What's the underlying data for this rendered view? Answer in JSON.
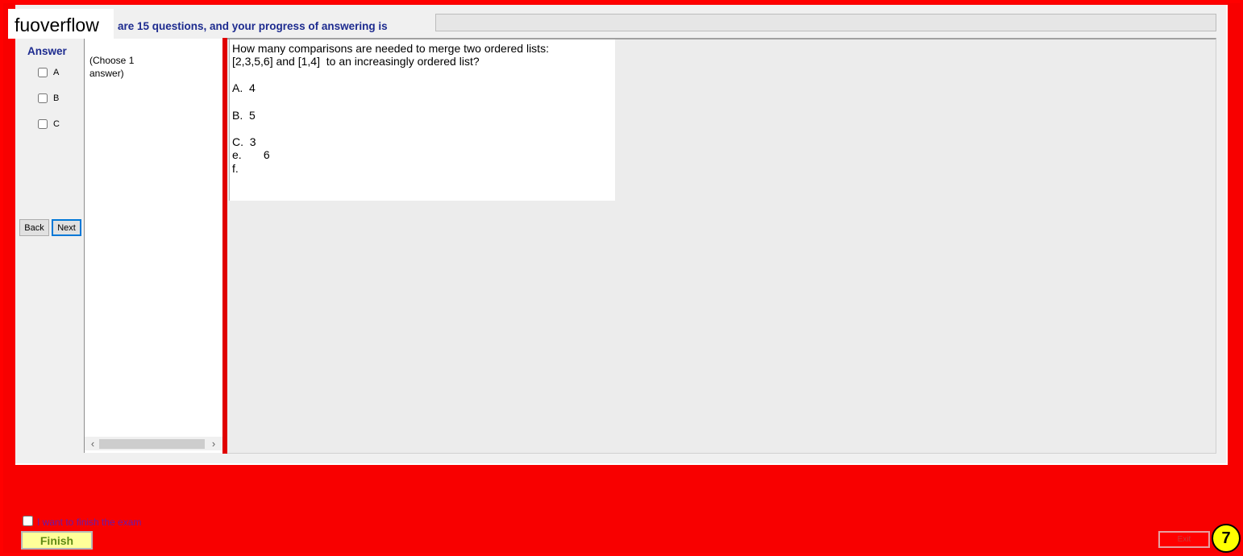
{
  "header": {
    "brand": "fuoverflow",
    "progress_text": "are 15 questions, and your progress of answering is",
    "progress_fraction": 0
  },
  "answer_panel": {
    "title": "Answer",
    "options": [
      {
        "label": "A",
        "checked": false
      },
      {
        "label": "B",
        "checked": false
      },
      {
        "label": "C",
        "checked": false
      }
    ],
    "back_label": "Back",
    "next_label": "Next"
  },
  "hint": {
    "text": "(Choose 1 answer)"
  },
  "question": {
    "lines": [
      "How many comparisons are needed to merge two ordered lists:",
      "[2,3,5,6] and [1,4]  to an increasingly ordered list?",
      "",
      "A.  4",
      "",
      "B.  5",
      "",
      "C.  3",
      "e.       6",
      "f."
    ]
  },
  "footer": {
    "finish_check_label": "I want to finish the exam",
    "finish_label": "Finish",
    "exit_label": "Exit",
    "question_number": "7"
  },
  "colors": {
    "background": "#ff0000",
    "accent_blue": "#1d2b8f",
    "finish_bg": "#ffff99",
    "badge_bg": "#ffff00"
  }
}
